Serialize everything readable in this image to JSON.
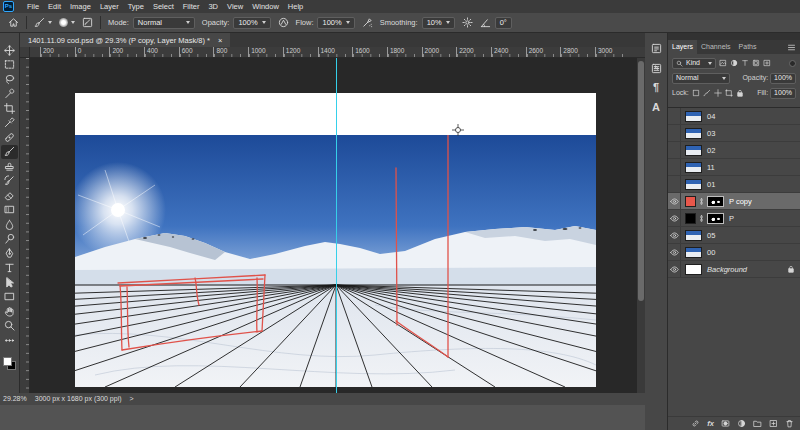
{
  "app": {
    "logo": "Ps"
  },
  "menu": [
    "File",
    "Edit",
    "Image",
    "Layer",
    "Type",
    "Select",
    "Filter",
    "3D",
    "View",
    "Window",
    "Help"
  ],
  "options": {
    "mode_label": "Mode:",
    "mode": "Normal",
    "opacity_label": "Opacity:",
    "opacity": "100%",
    "flow_label": "Flow:",
    "flow": "100%",
    "smoothing_label": "Smoothing:",
    "smoothing": "10%",
    "angle": "0°"
  },
  "tools": [
    {
      "kind": "move",
      "selected": false
    },
    {
      "kind": "marquee",
      "selected": false
    },
    {
      "kind": "lasso",
      "selected": false
    },
    {
      "kind": "quick-select",
      "selected": false
    },
    {
      "kind": "crop",
      "selected": false
    },
    {
      "kind": "eyedropper",
      "selected": false
    },
    {
      "kind": "healing",
      "selected": false
    },
    {
      "kind": "brush",
      "selected": true
    },
    {
      "kind": "stamp",
      "selected": false
    },
    {
      "kind": "history-brush",
      "selected": false
    },
    {
      "kind": "eraser",
      "selected": false
    },
    {
      "kind": "gradient",
      "selected": false
    },
    {
      "kind": "blur",
      "selected": false
    },
    {
      "kind": "dodge",
      "selected": false
    },
    {
      "kind": "pen",
      "selected": false
    },
    {
      "kind": "type",
      "selected": false
    },
    {
      "kind": "path-select",
      "selected": false
    },
    {
      "kind": "rectangle",
      "selected": false
    },
    {
      "kind": "hand",
      "selected": false
    },
    {
      "kind": "zoom",
      "selected": false
    },
    {
      "kind": "more",
      "selected": false
    }
  ],
  "document": {
    "title": "1401.11.09 cod.psd @ 29.3% (P copy, Layer Mask/8) *",
    "close": "×"
  },
  "ruler": {
    "ticks": [
      "200",
      "0",
      "200",
      "400",
      "600",
      "800",
      "1000",
      "1200",
      "1400",
      "1600",
      "1800",
      "2000",
      "2200",
      "2400",
      "2600",
      "2800",
      "3000"
    ]
  },
  "status_bar": {
    "zoom": "29.28%",
    "size": "3000 px x 1680 px (300 ppi)",
    "arrow": ">"
  },
  "side_icons": [
    {
      "kind": "history",
      "glyph": ""
    },
    {
      "kind": "properties",
      "glyph": ""
    },
    {
      "kind": "glyph",
      "glyph": "¶"
    },
    {
      "kind": "glyph",
      "glyph": "A"
    }
  ],
  "panel_tabs": [
    {
      "label": "Layers",
      "selected": true
    },
    {
      "label": "Channels",
      "selected": false
    },
    {
      "label": "Paths",
      "selected": false
    }
  ],
  "layers_panel": {
    "filter": "Kind",
    "blend": "Normal",
    "opacity_label": "Opacity:",
    "opacity": "100%",
    "lock_label": "Lock:",
    "fill_label": "Fill:",
    "fill": "100%",
    "fx": "fx"
  },
  "layers": [
    {
      "name": "04",
      "kind": "photo",
      "visible": false,
      "selected": false,
      "locked": false
    },
    {
      "name": "03",
      "kind": "photo",
      "visible": false,
      "selected": false,
      "locked": false
    },
    {
      "name": "02",
      "kind": "photo",
      "visible": false,
      "selected": false,
      "locked": false
    },
    {
      "name": "11",
      "kind": "photo",
      "visible": false,
      "selected": false,
      "locked": false
    },
    {
      "name": "01",
      "kind": "photo",
      "visible": false,
      "selected": false,
      "locked": false
    },
    {
      "name": "P copy",
      "kind": "fill",
      "color": "#e8574b",
      "visible": true,
      "selected": true,
      "locked": false
    },
    {
      "name": "P",
      "kind": "fill",
      "color": "#000000",
      "visible": true,
      "selected": false,
      "locked": false
    },
    {
      "name": "05",
      "kind": "photo",
      "visible": true,
      "selected": false,
      "locked": false
    },
    {
      "name": "00",
      "kind": "photo",
      "visible": true,
      "selected": false,
      "locked": false
    },
    {
      "name": "Background",
      "kind": "white",
      "visible": true,
      "selected": false,
      "locked": true
    }
  ]
}
